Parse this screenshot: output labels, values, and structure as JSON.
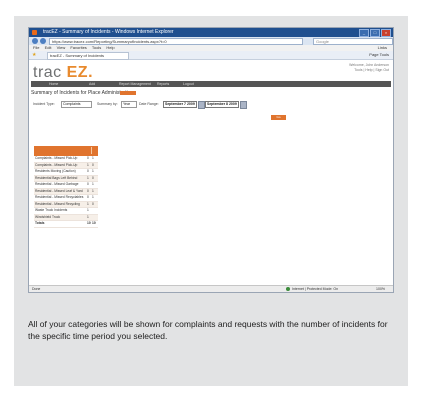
{
  "browser": {
    "window_title": "tracEZ - Summary of Incidents - Windows Internet Explorer",
    "url": "https://www.tracez.com/Reporting/SummaryofIncidents.aspx?t=0",
    "search_placeholder": "Google",
    "menu": [
      "File",
      "Edit",
      "View",
      "Favorites",
      "Tools",
      "Help"
    ],
    "links_label": "Links",
    "tab_title": "tracEZ - Summary of Incidents",
    "toolbar_tools": "Page  Tools",
    "status_text": "Done",
    "zone_text": "Internet | Protected Mode: On",
    "zoom_text": "100%"
  },
  "app": {
    "logo_trac": "trac",
    "logo_ez": "EZ.",
    "user_line1": "Welcome, John Anderson",
    "user_line2": "Tools | Help | Sign Out",
    "nav": [
      "Home",
      "Add",
      "Report Management",
      "Reports",
      "Logout"
    ],
    "heading": "Summary of Incidents for Place Administration",
    "filters": {
      "incident_type_label": "Incident Type:",
      "incident_type_value": "Complaints",
      "summary_by_label": "Summary by:",
      "summary_by_value": "Year",
      "date_range_label": "Date Range:",
      "date_from": "September 7 2009",
      "date_to": "September 8 2009"
    },
    "go_label": "Go",
    "table": {
      "rows": [
        {
          "category": "Complaints - Missed Pick-Up",
          "a": "0",
          "b": "1"
        },
        {
          "category": "Complaints - Missed Pick-Up",
          "a": "1",
          "b": "0"
        },
        {
          "category": "Residents Moving (Caution)",
          "a": "0",
          "b": "1"
        },
        {
          "category": "Residential Bags Left Behind",
          "a": "1",
          "b": "0"
        },
        {
          "category": "Residential - Missed Garbage",
          "a": "0",
          "b": "1"
        },
        {
          "category": "Residential - Missed Leaf & Yard",
          "a": "0",
          "b": "1"
        },
        {
          "category": "Residential - Missed Recyclables",
          "a": "0",
          "b": "1"
        },
        {
          "category": "Residential - Missed Recycling",
          "a": "1",
          "b": "0"
        },
        {
          "category": "Waste Truck Incidents",
          "a": "1",
          "b": ""
        },
        {
          "category": "Windshield Truck",
          "a": "1",
          "b": ""
        }
      ],
      "total_label": "Totals",
      "total_a": "10",
      "total_b": "10"
    }
  },
  "caption": "All of your categories will be shown for complaints and requests with the number of incidents for the specific time period you selected."
}
